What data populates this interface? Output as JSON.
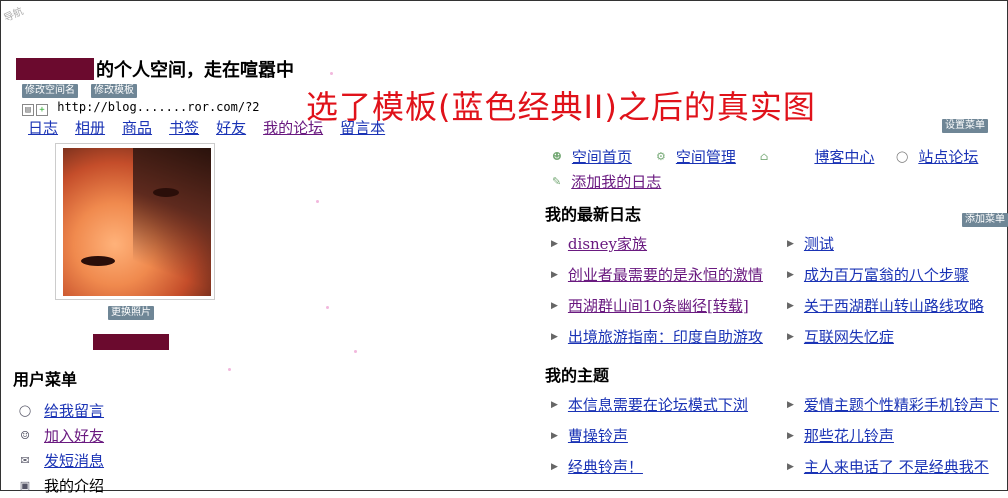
{
  "corner_label": "导航",
  "header": {
    "space_title": "的个人空间，走在喧嚣中",
    "edit_name_btn": "修改空间名",
    "edit_template_btn": "修改模板",
    "url": "http://blog.......ror.com/?2"
  },
  "top_nav": [
    "日志",
    "相册",
    "商品",
    "书签",
    "好友",
    "我的论坛",
    "留言本"
  ],
  "overlay_caption": "选了模板(蓝色经典II)之后的真实图",
  "photo": {
    "change_btn": "更换照片"
  },
  "user_menu": {
    "title": "用户菜单",
    "items": [
      {
        "icon": "speech-bubble-icon",
        "label": "给我留言"
      },
      {
        "icon": "add-friend-icon",
        "label": "加入好友"
      },
      {
        "icon": "envelope-icon",
        "label": "发短消息"
      },
      {
        "icon": "profile-card-icon",
        "label": "我的介绍"
      }
    ]
  },
  "right_nav": {
    "items": [
      {
        "icon": "user-icon",
        "label": "空间首页"
      },
      {
        "icon": "gear-icon",
        "label": "空间管理"
      },
      {
        "icon": "home-icon",
        "label": "博客中心"
      },
      {
        "icon": "speech-bubble-icon",
        "label": "站点论坛"
      }
    ],
    "add_post": {
      "icon": "pencil-icon",
      "label": "添加我的日志"
    }
  },
  "settings_menu_btn": "设置菜单",
  "add_menu_btn": "添加菜单",
  "latest_posts": {
    "title": "我的最新日志",
    "left": [
      "disney家族",
      "创业者最需要的是永恒的激情",
      "西湖群山间10条幽径[转载]",
      "出境旅游指南：印度自助游攻"
    ],
    "right": [
      "测试",
      "成为百万富翁的八个步骤",
      "关于西湖群山转山路线攻略",
      "互联网失忆症"
    ]
  },
  "my_topics": {
    "title": "我的主题",
    "left": [
      "本信息需要在论坛模式下浏",
      "曹操铃声",
      "经典铃声！"
    ],
    "right": [
      "爱情主题个性精彩手机铃声下",
      "那些花儿铃声",
      "主人来电话了 不是经典我不"
    ]
  }
}
